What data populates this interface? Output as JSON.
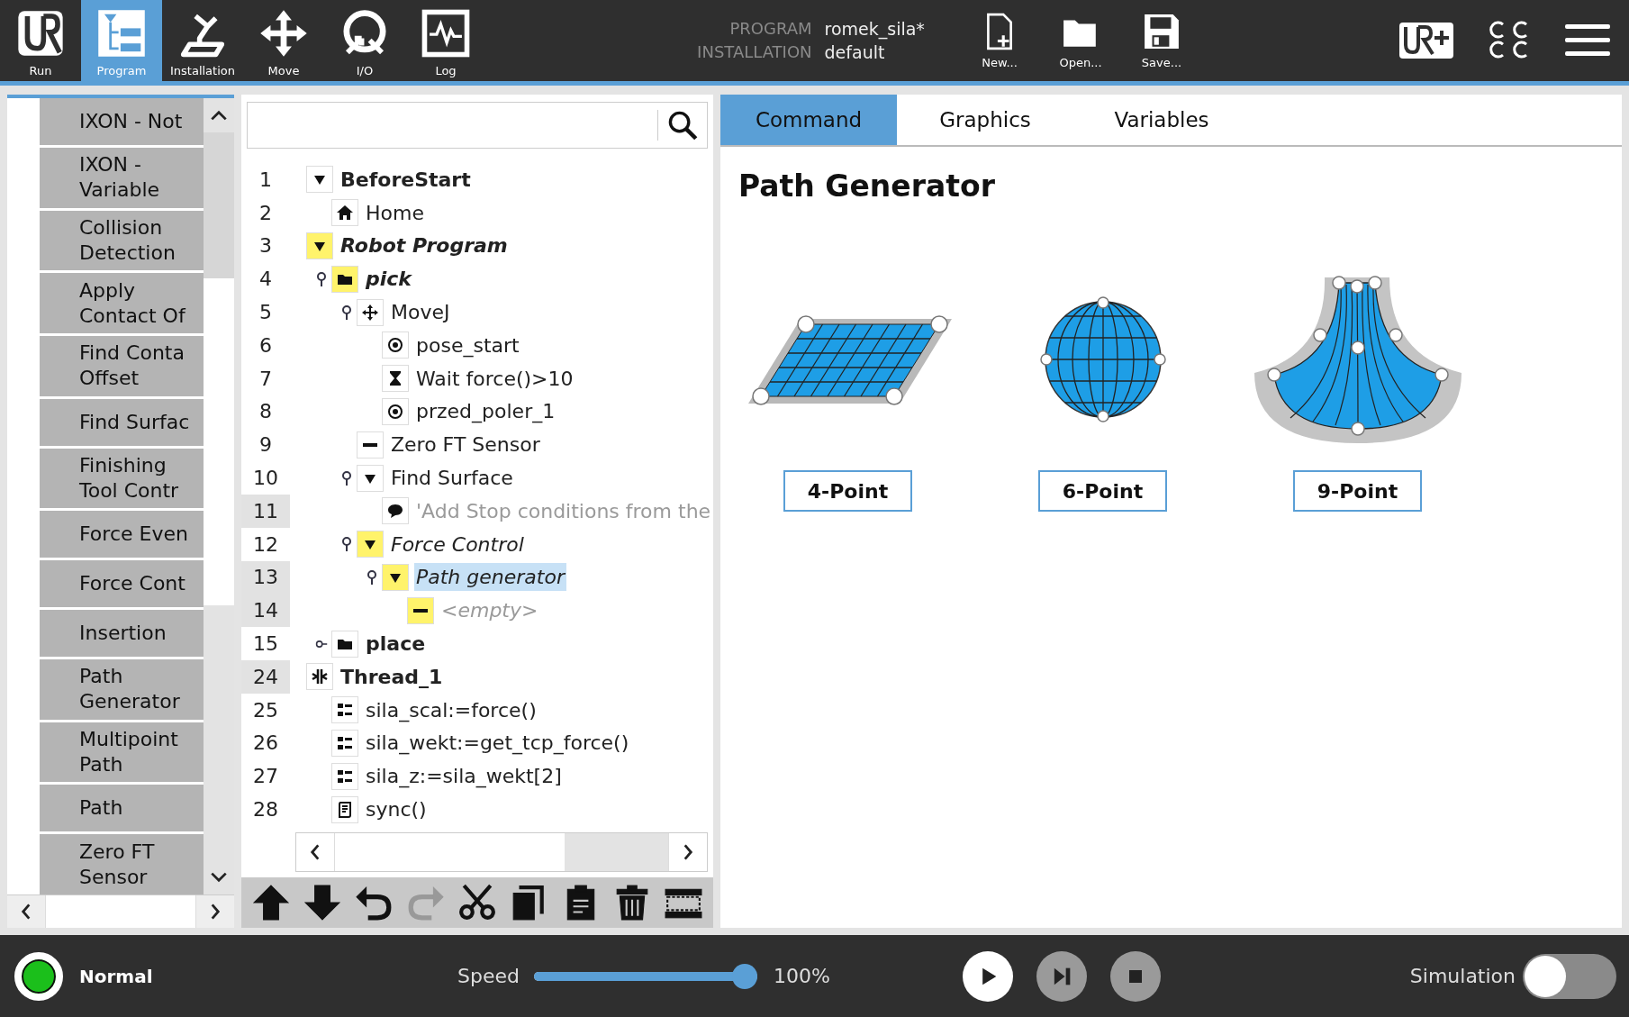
{
  "nav": {
    "tabs": [
      {
        "label": "Run",
        "kind": "logo",
        "selected": false
      },
      {
        "label": "Program",
        "kind": "program",
        "selected": true
      },
      {
        "label": "Installation",
        "kind": "installation",
        "selected": false
      },
      {
        "label": "Move",
        "kind": "move",
        "selected": false
      },
      {
        "label": "I/O",
        "kind": "io",
        "selected": false
      },
      {
        "label": "Log",
        "kind": "log",
        "selected": false
      }
    ]
  },
  "program_info": {
    "program_label": "PROGRAM",
    "program_name": "romek_sila*",
    "installation_label": "INSTALLATION",
    "installation_name": "default"
  },
  "file_buttons": [
    {
      "label": "New...",
      "kind": "new"
    },
    {
      "label": "Open...",
      "kind": "open"
    },
    {
      "label": "Save...",
      "kind": "save"
    }
  ],
  "sidebar": {
    "items": [
      {
        "label": "IXON - Not"
      },
      {
        "label": "IXON -\nVariable"
      },
      {
        "label": "Collision\nDetection"
      },
      {
        "label": "Apply\nContact Of"
      },
      {
        "label": "Find Conta\nOffset"
      },
      {
        "label": "Find Surfac"
      },
      {
        "label": "Finishing\nTool Contr"
      },
      {
        "label": "Force Even"
      },
      {
        "label": "Force Cont"
      },
      {
        "label": "Insertion"
      },
      {
        "label": "Path\nGenerator"
      },
      {
        "label": "Multipoint\nPath"
      },
      {
        "label": "Path"
      },
      {
        "label": "Zero FT\nSensor"
      }
    ]
  },
  "tree": {
    "nodes": [
      {
        "number": "1",
        "label": "BeforeStart",
        "kind": "expander",
        "highlighted": false,
        "bold": true,
        "italic": false,
        "dimmed": false,
        "pinned": false,
        "collapsed": false,
        "selected": false,
        "shaded": false,
        "children": [
          {
            "number": "2",
            "label": "Home",
            "kind": "home",
            "highlighted": false,
            "bold": false,
            "italic": false,
            "dimmed": false,
            "pinned": false,
            "collapsed": false,
            "selected": false,
            "shaded": false
          }
        ]
      },
      {
        "number": "3",
        "label": "Robot Program",
        "kind": "expander",
        "highlighted": true,
        "bold": true,
        "italic": true,
        "dimmed": false,
        "pinned": false,
        "collapsed": false,
        "selected": false,
        "shaded": false,
        "children": [
          {
            "number": "4",
            "label": "pick",
            "kind": "folder",
            "highlighted": true,
            "bold": true,
            "italic": true,
            "dimmed": false,
            "pinned": true,
            "collapsed": false,
            "selected": false,
            "shaded": false,
            "children": [
              {
                "number": "5",
                "label": "MoveJ",
                "kind": "move",
                "highlighted": false,
                "bold": false,
                "italic": false,
                "dimmed": false,
                "pinned": true,
                "collapsed": false,
                "selected": false,
                "shaded": false,
                "children": [
                  {
                    "number": "6",
                    "label": "pose_start",
                    "kind": "waypoint",
                    "highlighted": false,
                    "bold": false,
                    "italic": false,
                    "dimmed": false,
                    "pinned": false,
                    "collapsed": false,
                    "selected": false,
                    "shaded": false
                  },
                  {
                    "number": "7",
                    "label": "Wait force()>10",
                    "kind": "wait",
                    "highlighted": false,
                    "bold": false,
                    "italic": false,
                    "dimmed": false,
                    "pinned": false,
                    "collapsed": false,
                    "selected": false,
                    "shaded": false
                  },
                  {
                    "number": "8",
                    "label": "przed_poler_1",
                    "kind": "waypoint",
                    "highlighted": false,
                    "bold": false,
                    "italic": false,
                    "dimmed": false,
                    "pinned": false,
                    "collapsed": false,
                    "selected": false,
                    "shaded": false
                  }
                ]
              },
              {
                "number": "9",
                "label": "Zero FT Sensor",
                "kind": "dash",
                "highlighted": false,
                "bold": false,
                "italic": false,
                "dimmed": false,
                "pinned": false,
                "collapsed": false,
                "selected": false,
                "shaded": false
              },
              {
                "number": "10",
                "label": "Find Surface",
                "kind": "expander",
                "highlighted": false,
                "bold": false,
                "italic": false,
                "dimmed": false,
                "pinned": true,
                "collapsed": false,
                "selected": false,
                "shaded": false,
                "children": [
                  {
                    "number": "11",
                    "label": "'Add Stop conditions from the",
                    "kind": "comment",
                    "highlighted": false,
                    "bold": false,
                    "italic": false,
                    "dimmed": true,
                    "pinned": false,
                    "collapsed": false,
                    "selected": false,
                    "shaded": true
                  }
                ]
              },
              {
                "number": "12",
                "label": "Force Control",
                "kind": "expander",
                "highlighted": true,
                "bold": false,
                "italic": true,
                "dimmed": false,
                "pinned": true,
                "collapsed": false,
                "selected": false,
                "shaded": false,
                "children": [
                  {
                    "number": "13",
                    "label": "Path generator",
                    "kind": "expander",
                    "highlighted": true,
                    "bold": false,
                    "italic": true,
                    "dimmed": false,
                    "pinned": true,
                    "collapsed": false,
                    "selected": true,
                    "shaded": true,
                    "children": [
                      {
                        "number": "14",
                        "label": "<empty>",
                        "kind": "dash",
                        "highlighted": true,
                        "bold": false,
                        "italic": true,
                        "dimmed": true,
                        "pinned": false,
                        "collapsed": false,
                        "selected": false,
                        "shaded": true
                      }
                    ]
                  }
                ]
              }
            ]
          },
          {
            "number": "15",
            "label": "place",
            "kind": "folder",
            "highlighted": false,
            "bold": true,
            "italic": false,
            "dimmed": false,
            "pinned": true,
            "collapsed": true,
            "selected": false,
            "shaded": false
          }
        ]
      },
      {
        "number": "24",
        "label": "Thread_1",
        "kind": "thread",
        "highlighted": false,
        "bold": true,
        "italic": false,
        "dimmed": false,
        "pinned": false,
        "collapsed": false,
        "selected": false,
        "shaded": true,
        "children": [
          {
            "number": "25",
            "label": "sila_scal:=force()",
            "kind": "assign",
            "highlighted": false,
            "bold": false,
            "italic": false,
            "dimmed": false,
            "pinned": false,
            "collapsed": false,
            "selected": false,
            "shaded": false
          },
          {
            "number": "26",
            "label": "sila_wekt:=get_tcp_force()",
            "kind": "assign",
            "highlighted": false,
            "bold": false,
            "italic": false,
            "dimmed": false,
            "pinned": false,
            "collapsed": false,
            "selected": false,
            "shaded": false
          },
          {
            "number": "27",
            "label": "sila_z:=sila_wekt[2]",
            "kind": "assign",
            "highlighted": false,
            "bold": false,
            "italic": false,
            "dimmed": false,
            "pinned": false,
            "collapsed": false,
            "selected": false,
            "shaded": false
          },
          {
            "number": "28",
            "label": "sync()",
            "kind": "script",
            "highlighted": false,
            "bold": false,
            "italic": false,
            "dimmed": false,
            "pinned": false,
            "collapsed": false,
            "selected": false,
            "shaded": false
          }
        ]
      }
    ]
  },
  "tree_toolbar": [
    {
      "kind": "up",
      "disabled": false
    },
    {
      "kind": "down",
      "disabled": false
    },
    {
      "kind": "undo",
      "disabled": false
    },
    {
      "kind": "redo",
      "disabled": true
    },
    {
      "kind": "cut",
      "disabled": false
    },
    {
      "kind": "copy",
      "disabled": false
    },
    {
      "kind": "paste",
      "disabled": false
    },
    {
      "kind": "delete",
      "disabled": false
    },
    {
      "kind": "suppress",
      "disabled": false
    }
  ],
  "tabs": [
    {
      "label": "Command",
      "selected": true
    },
    {
      "label": "Graphics",
      "selected": false
    },
    {
      "label": "Variables",
      "selected": false
    }
  ],
  "command": {
    "title": "Path Generator",
    "patterns": [
      {
        "kind": "grid",
        "button": "4-Point"
      },
      {
        "kind": "sphere",
        "button": "6-Point"
      },
      {
        "kind": "fan",
        "button": "9-Point"
      }
    ]
  },
  "status_bar": {
    "state": "Normal",
    "speed_label": "Speed",
    "speed": {
      "level": 1.0,
      "reading": "100%"
    },
    "playback": [
      {
        "kind": "play",
        "disabled": false
      },
      {
        "kind": "step",
        "disabled": true
      },
      {
        "kind": "stop",
        "disabled": true
      }
    ],
    "simulation": {
      "label": "Simulation",
      "on": false
    }
  }
}
